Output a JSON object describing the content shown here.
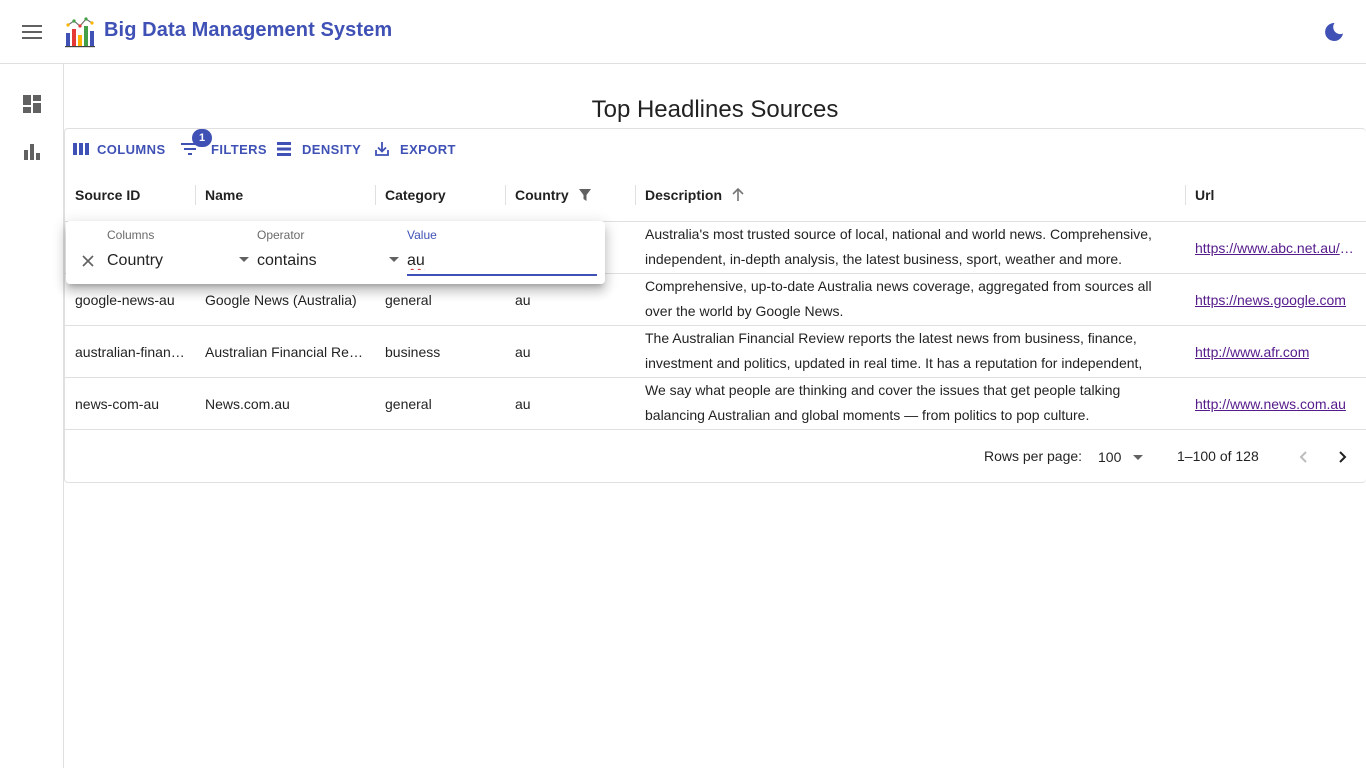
{
  "app": {
    "title": "Big Data Management System"
  },
  "icons": {
    "menu": "menu-icon",
    "logo": "bar-chart-logo",
    "theme": "dark-mode-moon-icon",
    "sidebar": [
      "dashboard-icon",
      "bar-chart-icon"
    ]
  },
  "colors": {
    "primary": "#3f51b5",
    "link": "#551a8b"
  },
  "page": {
    "title": "Top Headlines Sources"
  },
  "toolbar": {
    "columns": "Columns",
    "filters": "Filters",
    "filters_badge": "1",
    "density": "Density",
    "export": "Export"
  },
  "table": {
    "columns": [
      "Source ID",
      "Name",
      "Category",
      "Country",
      "Description",
      "Url"
    ],
    "sort": {
      "column": "Description",
      "direction": "asc"
    },
    "filtered_column": "Country",
    "rows": [
      {
        "source_id": "",
        "name": "",
        "category": "",
        "country": "",
        "description": "Australia's most trusted source of local, national and world news. Comprehensive, independent, in-depth analysis, the latest business, sport, weather and more.",
        "url": "https://www.abc.net.au/news"
      },
      {
        "source_id": "google-news-au",
        "name": "Google News (Australia)",
        "category": "general",
        "country": "au",
        "description": "Comprehensive, up-to-date Australia news coverage, aggregated from sources all over the world by Google News.",
        "url": "https://news.google.com"
      },
      {
        "source_id": "australian-financial-review",
        "name": "Australian Financial Review",
        "category": "business",
        "country": "au",
        "description": "The Australian Financial Review reports the latest news from business, finance, investment and politics, updated in real time. It has a reputation for independent,",
        "url": "http://www.afr.com"
      },
      {
        "source_id": "news-com-au",
        "name": "News.com.au",
        "category": "general",
        "country": "au",
        "description": "We say what people are thinking and cover the issues that get people talking balancing Australian and global moments — from politics to pop culture.",
        "url": "http://www.news.com.au"
      }
    ]
  },
  "pagination": {
    "rows_per_page_label": "Rows per page:",
    "rows_per_page": "100",
    "range": "1–100 of 128"
  },
  "filter_panel": {
    "columns_label": "Columns",
    "column_value": "Country",
    "operator_label": "Operator",
    "operator_value": "contains",
    "value_label": "Value",
    "value": "au"
  }
}
